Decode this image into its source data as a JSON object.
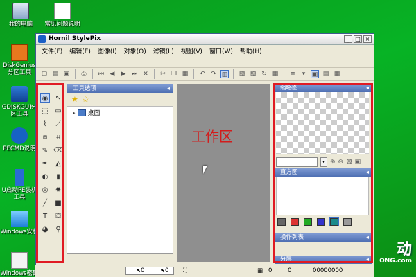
{
  "desktop": {
    "icons": [
      {
        "label": "我的电脑"
      },
      {
        "label": "常见问题说明"
      },
      {
        "label": "DiskGenius分区工具"
      },
      {
        "label": "GDISKGUI分区工具"
      },
      {
        "label": "PECMD说明"
      },
      {
        "label": "U启动PE装机工具"
      },
      {
        "label": "Windows安装"
      },
      {
        "label": "Windows密码"
      }
    ]
  },
  "window": {
    "title": "Hornil StylePix",
    "controls": [
      "_",
      "□",
      "×"
    ],
    "menu": [
      "文件(F)",
      "编辑(E)",
      "图像(I)",
      "对象(O)",
      "滤镜(L)",
      "视图(V)",
      "窗口(W)",
      "帮助(H)"
    ]
  },
  "panels": {
    "tool_options": "工具选项",
    "tree_item": "桌面",
    "thumbnail": "缩略图",
    "histogram": "直方图",
    "operations": "操作列表",
    "layers": "分层"
  },
  "workspace": {
    "label": "工作区"
  },
  "status": {
    "coord_x": "0",
    "coord_y": "0",
    "size": "00000000"
  },
  "brand": {
    "text": "动",
    "sub": "ONG.com"
  },
  "colors": {
    "highlight_box": "#e01b24",
    "workspace_label": "#d21c1c",
    "title_bar": "#4e6fb3"
  },
  "toolbar_icons": [
    "new-icon",
    "open-icon",
    "save-icon",
    "print-icon",
    "first-icon",
    "prev-icon",
    "next-icon",
    "last-icon",
    "close-icon",
    "cut-icon",
    "copy-icon",
    "paste-icon",
    "undo-icon",
    "redo-icon",
    "panel-icon"
  ]
}
